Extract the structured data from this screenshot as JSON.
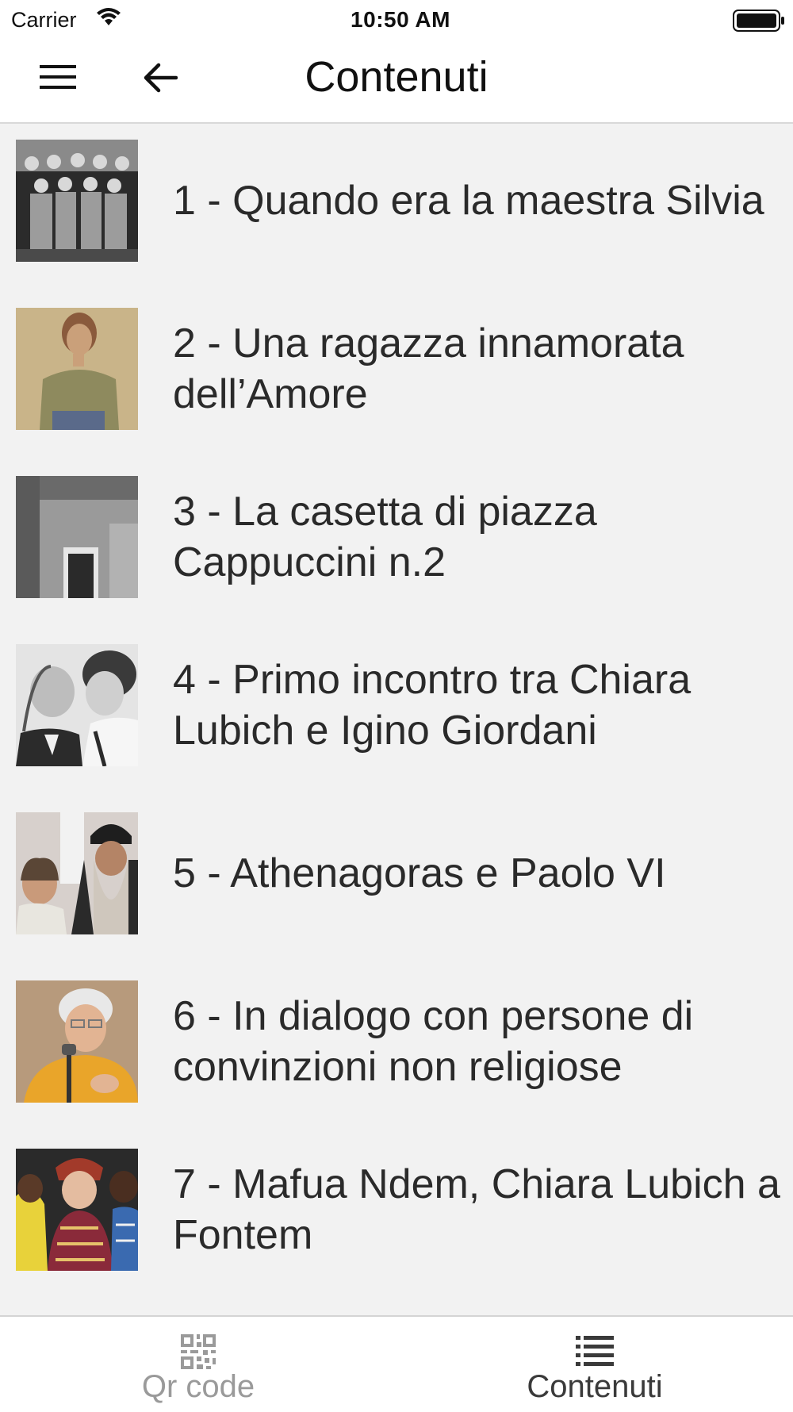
{
  "status_bar": {
    "carrier": "Carrier",
    "time": "10:50 AM",
    "icons": [
      "wifi-icon",
      "battery-icon"
    ]
  },
  "nav": {
    "title": "Contenuti",
    "icons": [
      "hamburger-menu-icon",
      "back-arrow-icon"
    ]
  },
  "items": [
    {
      "label": "1 - Quando era la maestra Silvia",
      "thumb_icon": "group-photo-thumbnail"
    },
    {
      "label": "2 - Una ragazza innamorata dell’Amore",
      "thumb_icon": "portrait-painting-thumbnail"
    },
    {
      "label": "3 - La casetta di piazza Cappuccini n.2",
      "thumb_icon": "house-photo-thumbnail"
    },
    {
      "label": "4 - Primo incontro tra Chiara Lubich e Igino Giordani",
      "thumb_icon": "two-people-photo-thumbnail"
    },
    {
      "label": "5 - Athenagoras e Paolo VI",
      "thumb_icon": "patriarch-photo-thumbnail"
    },
    {
      "label": "6 - In dialogo con persone di convinzioni non religiose",
      "thumb_icon": "speaker-photo-thumbnail"
    },
    {
      "label": "7 - Mafua Ndem, Chiara Lubich a Fontem",
      "thumb_icon": "ceremony-photo-thumbnail"
    }
  ],
  "tabs": {
    "qr": {
      "label": "Qr code",
      "icon": "qr-code-icon",
      "color": "#9a9a9a"
    },
    "contents": {
      "label": "Contenuti",
      "icon": "list-icon",
      "color": "#3a3a3a",
      "selected": true
    }
  },
  "colors": {
    "list_background": "#f2f2f2",
    "text": "#2a2a2a"
  }
}
